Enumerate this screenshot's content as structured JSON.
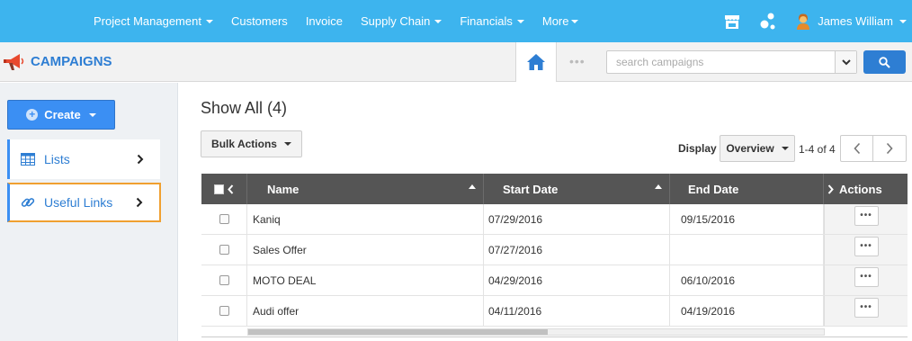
{
  "topnav": {
    "items": [
      {
        "label": "Project Management",
        "dropdown": true
      },
      {
        "label": "Customers",
        "dropdown": false
      },
      {
        "label": "Invoice",
        "dropdown": false
      },
      {
        "label": "Supply Chain",
        "dropdown": true
      },
      {
        "label": "Financials",
        "dropdown": true
      },
      {
        "label": "More",
        "dropdown": true
      }
    ],
    "user_name": "James William",
    "icons": [
      "store-icon",
      "share-icon",
      "user-avatar-icon"
    ]
  },
  "header": {
    "app_title": "CAMPAIGNS",
    "dots": "•••",
    "search_placeholder": "search campaigns"
  },
  "sidebar": {
    "create_label": "Create",
    "items": [
      {
        "label": "Lists",
        "icon": "table-icon"
      },
      {
        "label": "Useful Links",
        "icon": "link-icon"
      }
    ]
  },
  "main": {
    "title": "Show All (4)",
    "bulk_actions_label": "Bulk Actions",
    "display_label": "Display",
    "display_value": "Overview",
    "page_count": "1-4 of 4"
  },
  "table": {
    "columns": [
      "Name",
      "Start Date",
      "End Date",
      "Actions"
    ],
    "rows": [
      {
        "name": "Kaniq",
        "start": "07/29/2016",
        "end": "09/15/2016"
      },
      {
        "name": "Sales Offer",
        "start": "07/27/2016",
        "end": ""
      },
      {
        "name": "MOTO DEAL",
        "start": "04/29/2016",
        "end": "06/10/2016"
      },
      {
        "name": "Audi offer",
        "start": "04/11/2016",
        "end": "04/19/2016"
      }
    ],
    "row_action_label": "•••"
  },
  "colors": {
    "topnav_bg": "#3db4ee",
    "accent": "#2e7ed3",
    "table_header_bg": "#555555",
    "highlight_border": "#f0a030"
  }
}
